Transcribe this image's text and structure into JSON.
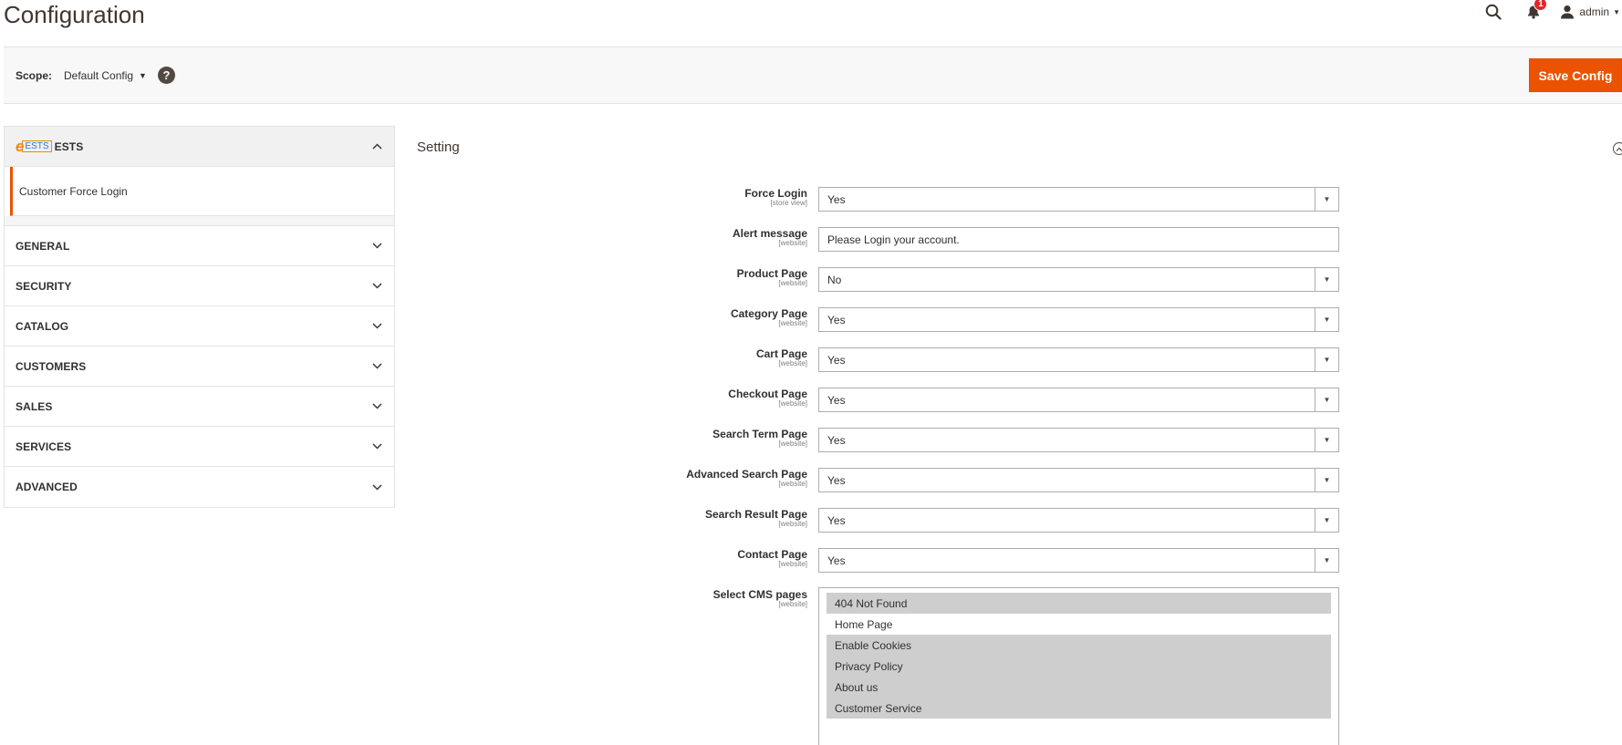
{
  "page": {
    "title": "Configuration"
  },
  "header": {
    "notification_count": "1",
    "user_name": "admin"
  },
  "scope": {
    "label": "Scope:",
    "value": "Default Config",
    "help": "?"
  },
  "actions": {
    "save_label": "Save Config"
  },
  "sidebar": {
    "brand_tab": {
      "logo_e": "e",
      "logo_box": "ESTS",
      "title": "ESTS",
      "items": [
        {
          "label": "Customer Force Login"
        }
      ]
    },
    "tabs": [
      {
        "label": "GENERAL"
      },
      {
        "label": "SECURITY"
      },
      {
        "label": "CATALOG"
      },
      {
        "label": "CUSTOMERS"
      },
      {
        "label": "SALES"
      },
      {
        "label": "SERVICES"
      },
      {
        "label": "ADVANCED"
      }
    ]
  },
  "section": {
    "title": "Setting",
    "fields": [
      {
        "label": "Force Login",
        "scope": "[store view]",
        "value": "Yes"
      },
      {
        "label": "Alert message",
        "scope": "[website]",
        "value": "Please Login your account."
      },
      {
        "label": "Product Page",
        "scope": "[website]",
        "value": "No"
      },
      {
        "label": "Category Page",
        "scope": "[website]",
        "value": "Yes"
      },
      {
        "label": "Cart Page",
        "scope": "[website]",
        "value": "Yes"
      },
      {
        "label": "Checkout Page",
        "scope": "[website]",
        "value": "Yes"
      },
      {
        "label": "Search Term Page",
        "scope": "[website]",
        "value": "Yes"
      },
      {
        "label": "Advanced Search Page",
        "scope": "[website]",
        "value": "Yes"
      },
      {
        "label": "Search Result Page",
        "scope": "[website]",
        "value": "Yes"
      },
      {
        "label": "Contact Page",
        "scope": "[website]",
        "value": "Yes"
      }
    ],
    "cms": {
      "label": "Select CMS pages",
      "scope": "[website]",
      "options": [
        {
          "label": "404 Not Found",
          "selected": true
        },
        {
          "label": "Home Page",
          "selected": false
        },
        {
          "label": "Enable Cookies",
          "selected": true
        },
        {
          "label": "Privacy Policy",
          "selected": true
        },
        {
          "label": "About us",
          "selected": true
        },
        {
          "label": "Customer Service",
          "selected": true
        }
      ]
    }
  },
  "colors": {
    "accent": "#eb5202",
    "badge": "#e22626",
    "selected_option": "#cecece"
  },
  "icons": {
    "search": "search-icon",
    "notifications": "bell-icon",
    "user": "user-icon",
    "help": "help-icon",
    "collapse": "chevron-up-circle-icon",
    "expand": "chevron-down-icon"
  }
}
